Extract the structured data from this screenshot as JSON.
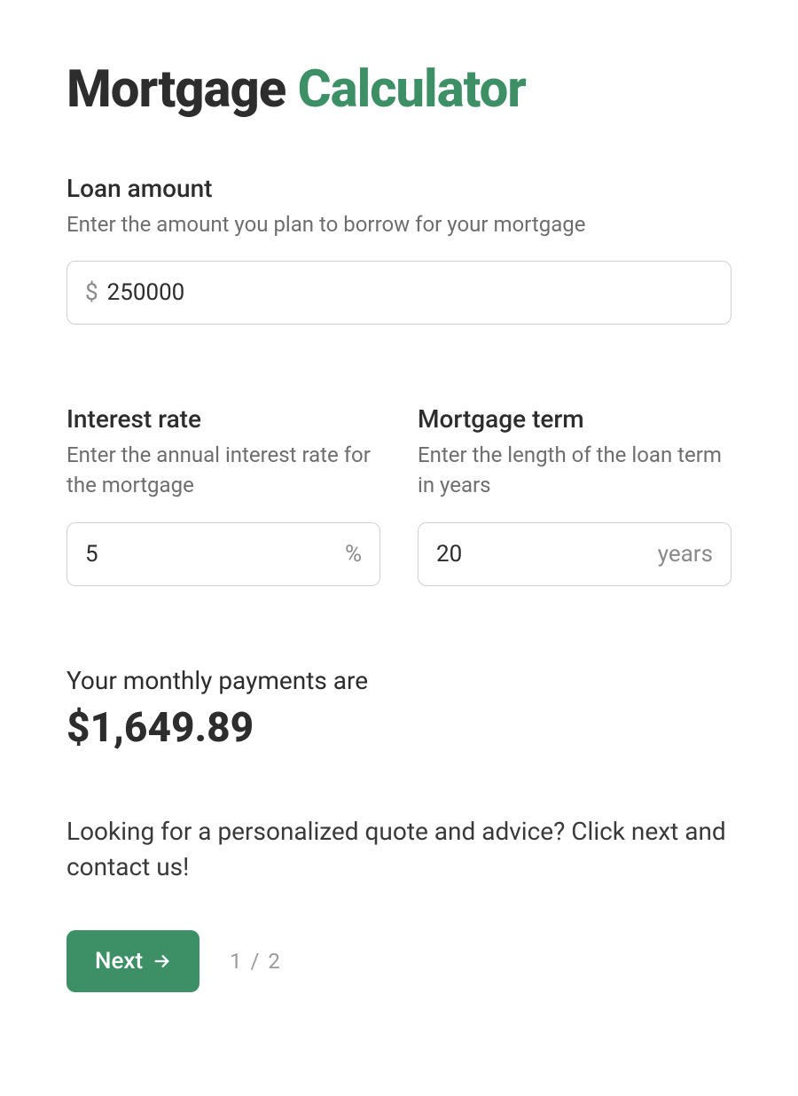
{
  "title": {
    "part1": "Mortgage ",
    "part2": "Calculator"
  },
  "fields": {
    "loan": {
      "label": "Loan amount",
      "desc": "Enter the amount you plan to borrow for your mortgage",
      "prefix": "$",
      "value": "250000"
    },
    "rate": {
      "label": "Interest rate",
      "desc": "Enter the annual interest rate for the mortgage",
      "suffix": "%",
      "value": "5"
    },
    "term": {
      "label": "Mortgage term",
      "desc": "Enter the length of the loan term in years",
      "suffix": "years",
      "value": "20"
    }
  },
  "result": {
    "label": "Your monthly payments are",
    "value": "$1,649.89"
  },
  "cta": "Looking for a personalized quote and advice? Click next and contact us!",
  "footer": {
    "next_label": "Next",
    "pager": "1 / 2"
  }
}
